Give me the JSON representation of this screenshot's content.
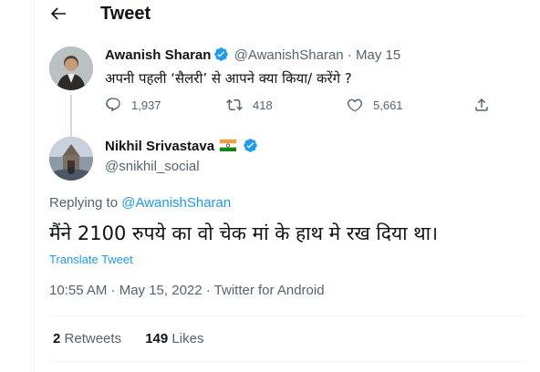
{
  "header": {
    "title": "Tweet"
  },
  "parent_tweet": {
    "author_name": "Awanish Sharan",
    "author_handle": "@AwanishSharan",
    "separator": "·",
    "date": "May 15",
    "text": "अपनी पहली ‘सैलरी’ से आपने क्या किया/ करेंगे ?",
    "replies": "1,937",
    "retweets": "418",
    "likes": "5,661"
  },
  "main_tweet": {
    "author_name": "Nikhil Srivastava",
    "author_handle": "@snikhil_social",
    "replying_prefix": "Replying to",
    "replying_handle": "@AwanishSharan",
    "text": "मैंने 2100 रुपये का वो चेक मां के हाथ मे रख दिया था।",
    "translate_label": "Translate Tweet",
    "timestamp": "10:55 AM · May 15, 2022 · Twitter for Android",
    "retweets_count": "2",
    "retweets_label": "Retweets",
    "likes_count": "149",
    "likes_label": "Likes"
  },
  "colors": {
    "accent": "#1d9bf0",
    "muted": "#536471",
    "text": "#0f1419",
    "divider": "#eff3f4"
  }
}
